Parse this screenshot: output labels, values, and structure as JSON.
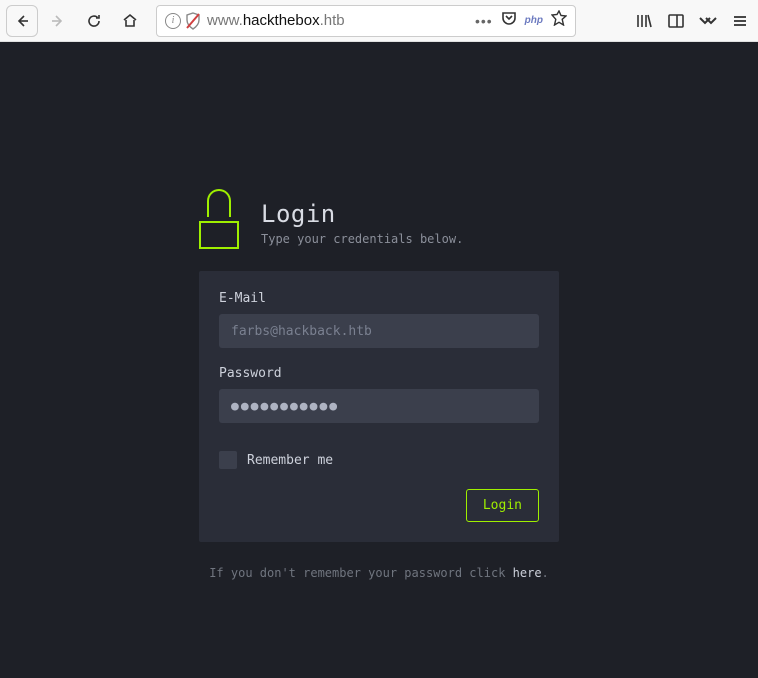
{
  "browser": {
    "url_prefix": "www.",
    "url_domain": "hackthebox",
    "url_suffix": ".htb",
    "php_badge": "php"
  },
  "page": {
    "title": "Login",
    "subtitle": "Type your credentials below.",
    "email_label": "E-Mail",
    "email_placeholder": "farbs@hackback.htb",
    "password_label": "Password",
    "password_value": "●●●●●●●●●●●",
    "remember_label": "Remember me",
    "login_button": "Login",
    "footer_prefix": "If you don't remember your password click ",
    "footer_link": "here",
    "footer_suffix": "."
  }
}
